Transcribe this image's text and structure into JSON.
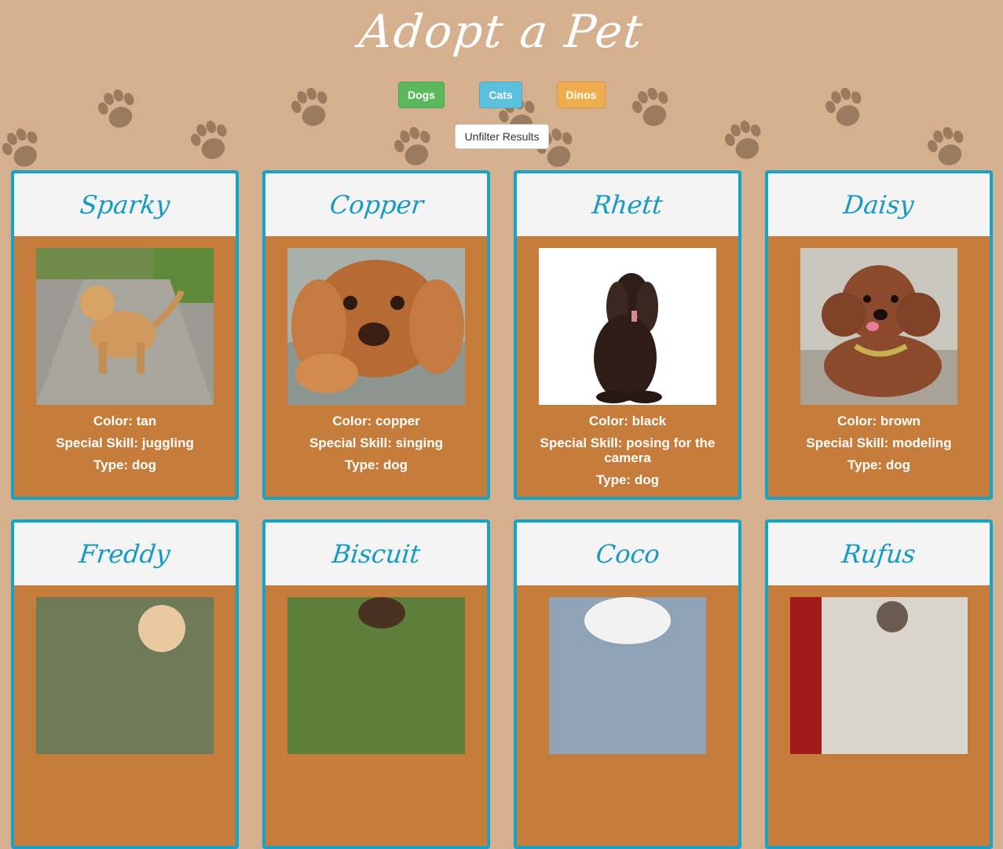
{
  "page": {
    "title": "Adopt a Pet"
  },
  "filters": {
    "dogs": {
      "label": "Dogs",
      "color": "#5cb85c"
    },
    "cats": {
      "label": "Cats",
      "color": "#5bc0de"
    },
    "dinos": {
      "label": "Dinos",
      "color": "#f0ad4e"
    },
    "unfilter": {
      "label": "Unfilter Results"
    }
  },
  "pets": [
    {
      "name": "Sparky",
      "color": "Color: tan",
      "skill": "Special Skill: juggling",
      "type": "Type: dog",
      "image": "golden-puppy-photo"
    },
    {
      "name": "Copper",
      "color": "Color: copper",
      "skill": "Special Skill: singing",
      "type": "Type: dog",
      "image": "spaniel-closeup-photo"
    },
    {
      "name": "Rhett",
      "color": "Color: black",
      "skill": "Special Skill: posing for the camera",
      "type": "Type: dog",
      "image": "black-spaniel-photo"
    },
    {
      "name": "Daisy",
      "color": "Color: brown",
      "skill": "Special Skill: modeling",
      "type": "Type: dog",
      "image": "brown-poodle-photo"
    },
    {
      "name": "Freddy",
      "image": "cat-photo"
    },
    {
      "name": "Biscuit",
      "image": "dog-grass-photo"
    },
    {
      "name": "Coco",
      "image": "white-cat-photo"
    },
    {
      "name": "Rufus",
      "image": "pet-photo"
    }
  ],
  "theme": {
    "background": "#d4b08f",
    "card_border": "#15a3c8",
    "card_body": "#c67d3b",
    "name_color": "#149bc3",
    "paw_color": "#9b7b5e"
  }
}
